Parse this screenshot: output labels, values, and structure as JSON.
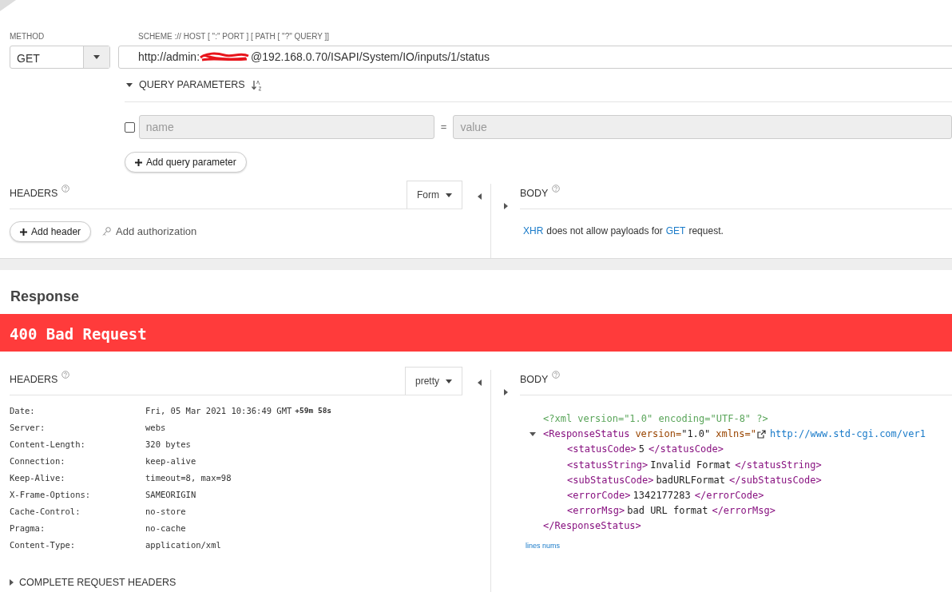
{
  "request": {
    "method_label": "METHOD",
    "method": "GET",
    "url_label": "SCHEME :// HOST [ \":\" PORT ] [ PATH [ \"?\" QUERY ]]",
    "url_prefix": "http://admin:",
    "url_redacted": true,
    "url_suffix": "@192.168.0.70/ISAPI/System/IO/inputs/1/status",
    "query": {
      "title": "QUERY PARAMETERS",
      "expanded": true,
      "params": [
        {
          "checked": false,
          "name_placeholder": "name",
          "equals": "=",
          "value_placeholder": "value"
        }
      ],
      "add_button": "Add query parameter"
    },
    "headers": {
      "title": "HEADERS",
      "mode": "Form",
      "add_button": "Add header",
      "auth_link": "Add authorization"
    },
    "body": {
      "title": "BODY",
      "note_link1": "XHR",
      "note_mid": "does not allow payloads for",
      "note_link2": "GET",
      "note_end": "request."
    }
  },
  "response": {
    "title": "Response",
    "status": "400 Bad Request",
    "headers": {
      "title": "HEADERS",
      "mode": "pretty",
      "rows": [
        {
          "name": "Date:",
          "value": "Fri, 05 Mar 2021 10:36:49 GMT",
          "delta": "+59m 58s"
        },
        {
          "name": "Server:",
          "value": "webs"
        },
        {
          "name": "Content-Length:",
          "value": "320 bytes"
        },
        {
          "name": "Connection:",
          "value": "keep-alive"
        },
        {
          "name": "Keep-Alive:",
          "value": "timeout=8, max=98"
        },
        {
          "name": "X-Frame-Options:",
          "value": "SAMEORIGIN"
        },
        {
          "name": "Cache-Control:",
          "value": "no-store"
        },
        {
          "name": "Pragma:",
          "value": "no-cache"
        },
        {
          "name": "Content-Type:",
          "value": "application/xml"
        }
      ],
      "complete_title": "COMPLETE REQUEST HEADERS",
      "complete_expanded": false
    },
    "body": {
      "title": "BODY",
      "lines": [
        {
          "kind": "decl",
          "text": "<?xml version=\"1.0\" encoding=\"UTF-8\" ?>"
        },
        {
          "kind": "root_open",
          "tag": "<ResponseStatus",
          "attr_name": "version=",
          "attr_value": "\"1.0\"",
          "ns_name": "xmlns=\"",
          "link": "http://www.std-cgi.com/ver1",
          "expanded": true
        },
        {
          "kind": "element",
          "open": "<statusCode>",
          "value": "5",
          "close": "</statusCode>"
        },
        {
          "kind": "element",
          "open": "<statusString>",
          "value": "Invalid Format",
          "close": "</statusString>"
        },
        {
          "kind": "element",
          "open": "<subStatusCode>",
          "value": "badURLFormat",
          "close": "</subStatusCode>"
        },
        {
          "kind": "element",
          "open": "<errorCode>",
          "value": "1342177283",
          "close": "</errorCode>"
        },
        {
          "kind": "element",
          "open": "<errorMsg>",
          "value": "bad URL format",
          "close": "</errorMsg>"
        },
        {
          "kind": "close",
          "text": "</ResponseStatus>"
        }
      ],
      "footer_link": "lines nums"
    }
  }
}
